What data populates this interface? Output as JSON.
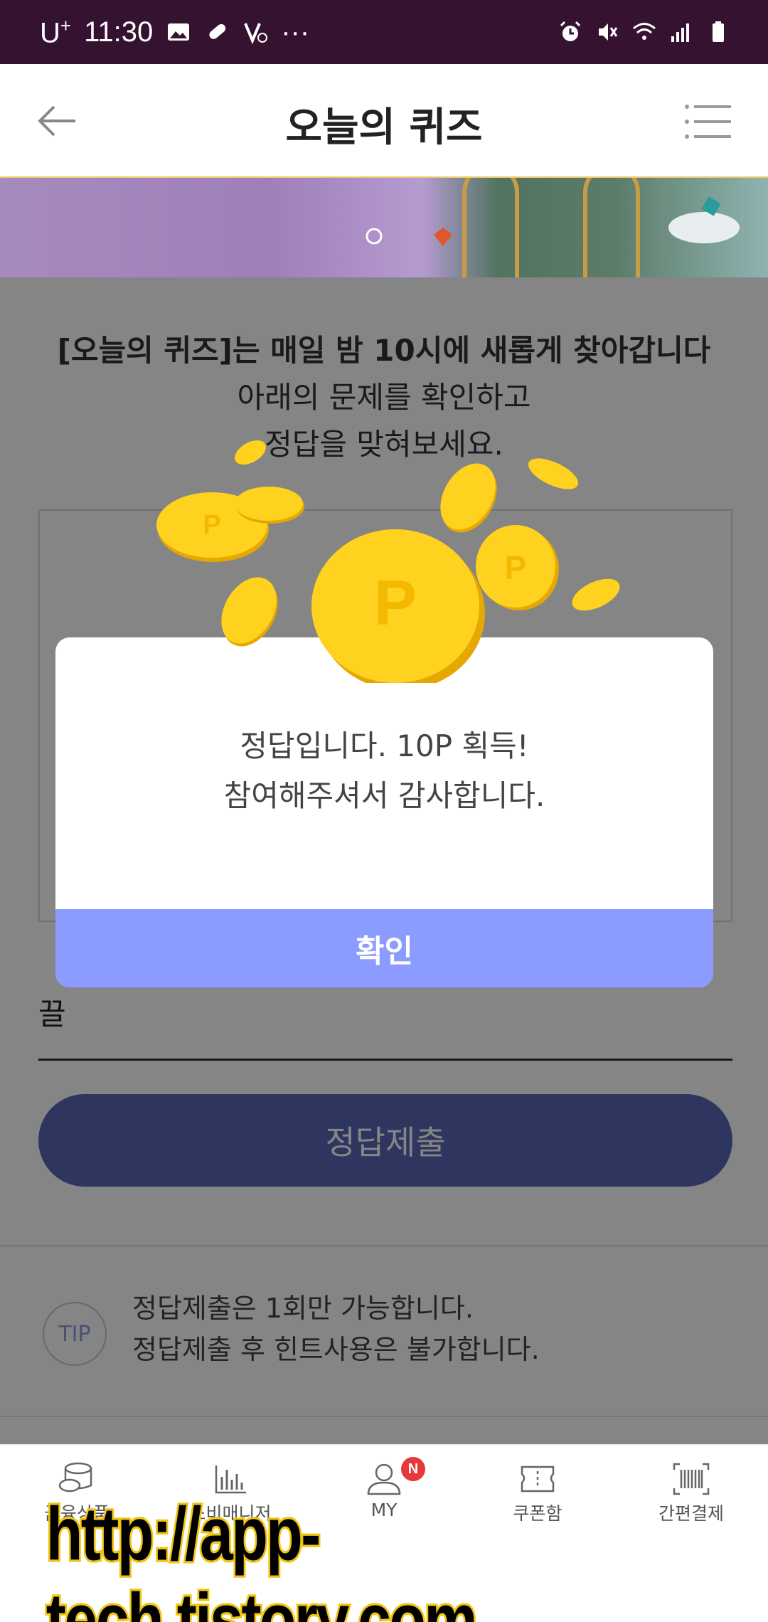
{
  "status_bar": {
    "carrier": "U",
    "carrier_sup": "+",
    "time": "11:30",
    "more": "···"
  },
  "header": {
    "title": "오늘의 퀴즈"
  },
  "intro": {
    "line1": "[오늘의 퀴즈]는 매일 밤 10시에 새롭게 찾아갑니다",
    "line2": "아래의 문제를 확인하고",
    "line3": "정답을 맞혀보세요."
  },
  "answer": {
    "value": "끌"
  },
  "submit_label": "정답제출",
  "tip": {
    "badge": "TIP",
    "line1": "정답제출은 1회만 가능합니다.",
    "line2": "정답제출 후 힌트사용은 불가합니다."
  },
  "dialog": {
    "line1": "정답입니다. 10P 획득!",
    "line2": "참여해주셔서 감사합니다.",
    "ok_label": "확인"
  },
  "bottom_nav": [
    {
      "label": "금융상품",
      "icon": "coins-stack-icon"
    },
    {
      "label": "소비매니저",
      "icon": "bar-chart-icon"
    },
    {
      "label": "MY",
      "icon": "person-icon",
      "badge": "N"
    },
    {
      "label": "쿠폰함",
      "icon": "coupon-icon"
    },
    {
      "label": "간편결제",
      "icon": "barcode-icon"
    }
  ],
  "watermark": "http://app-tech.tistory.com",
  "colors": {
    "status_bar": "#35122f",
    "submit_button": "#5968b8",
    "dialog_ok": "#8c9bff",
    "badge": "#e5393a",
    "coin": "#ffd21f"
  }
}
